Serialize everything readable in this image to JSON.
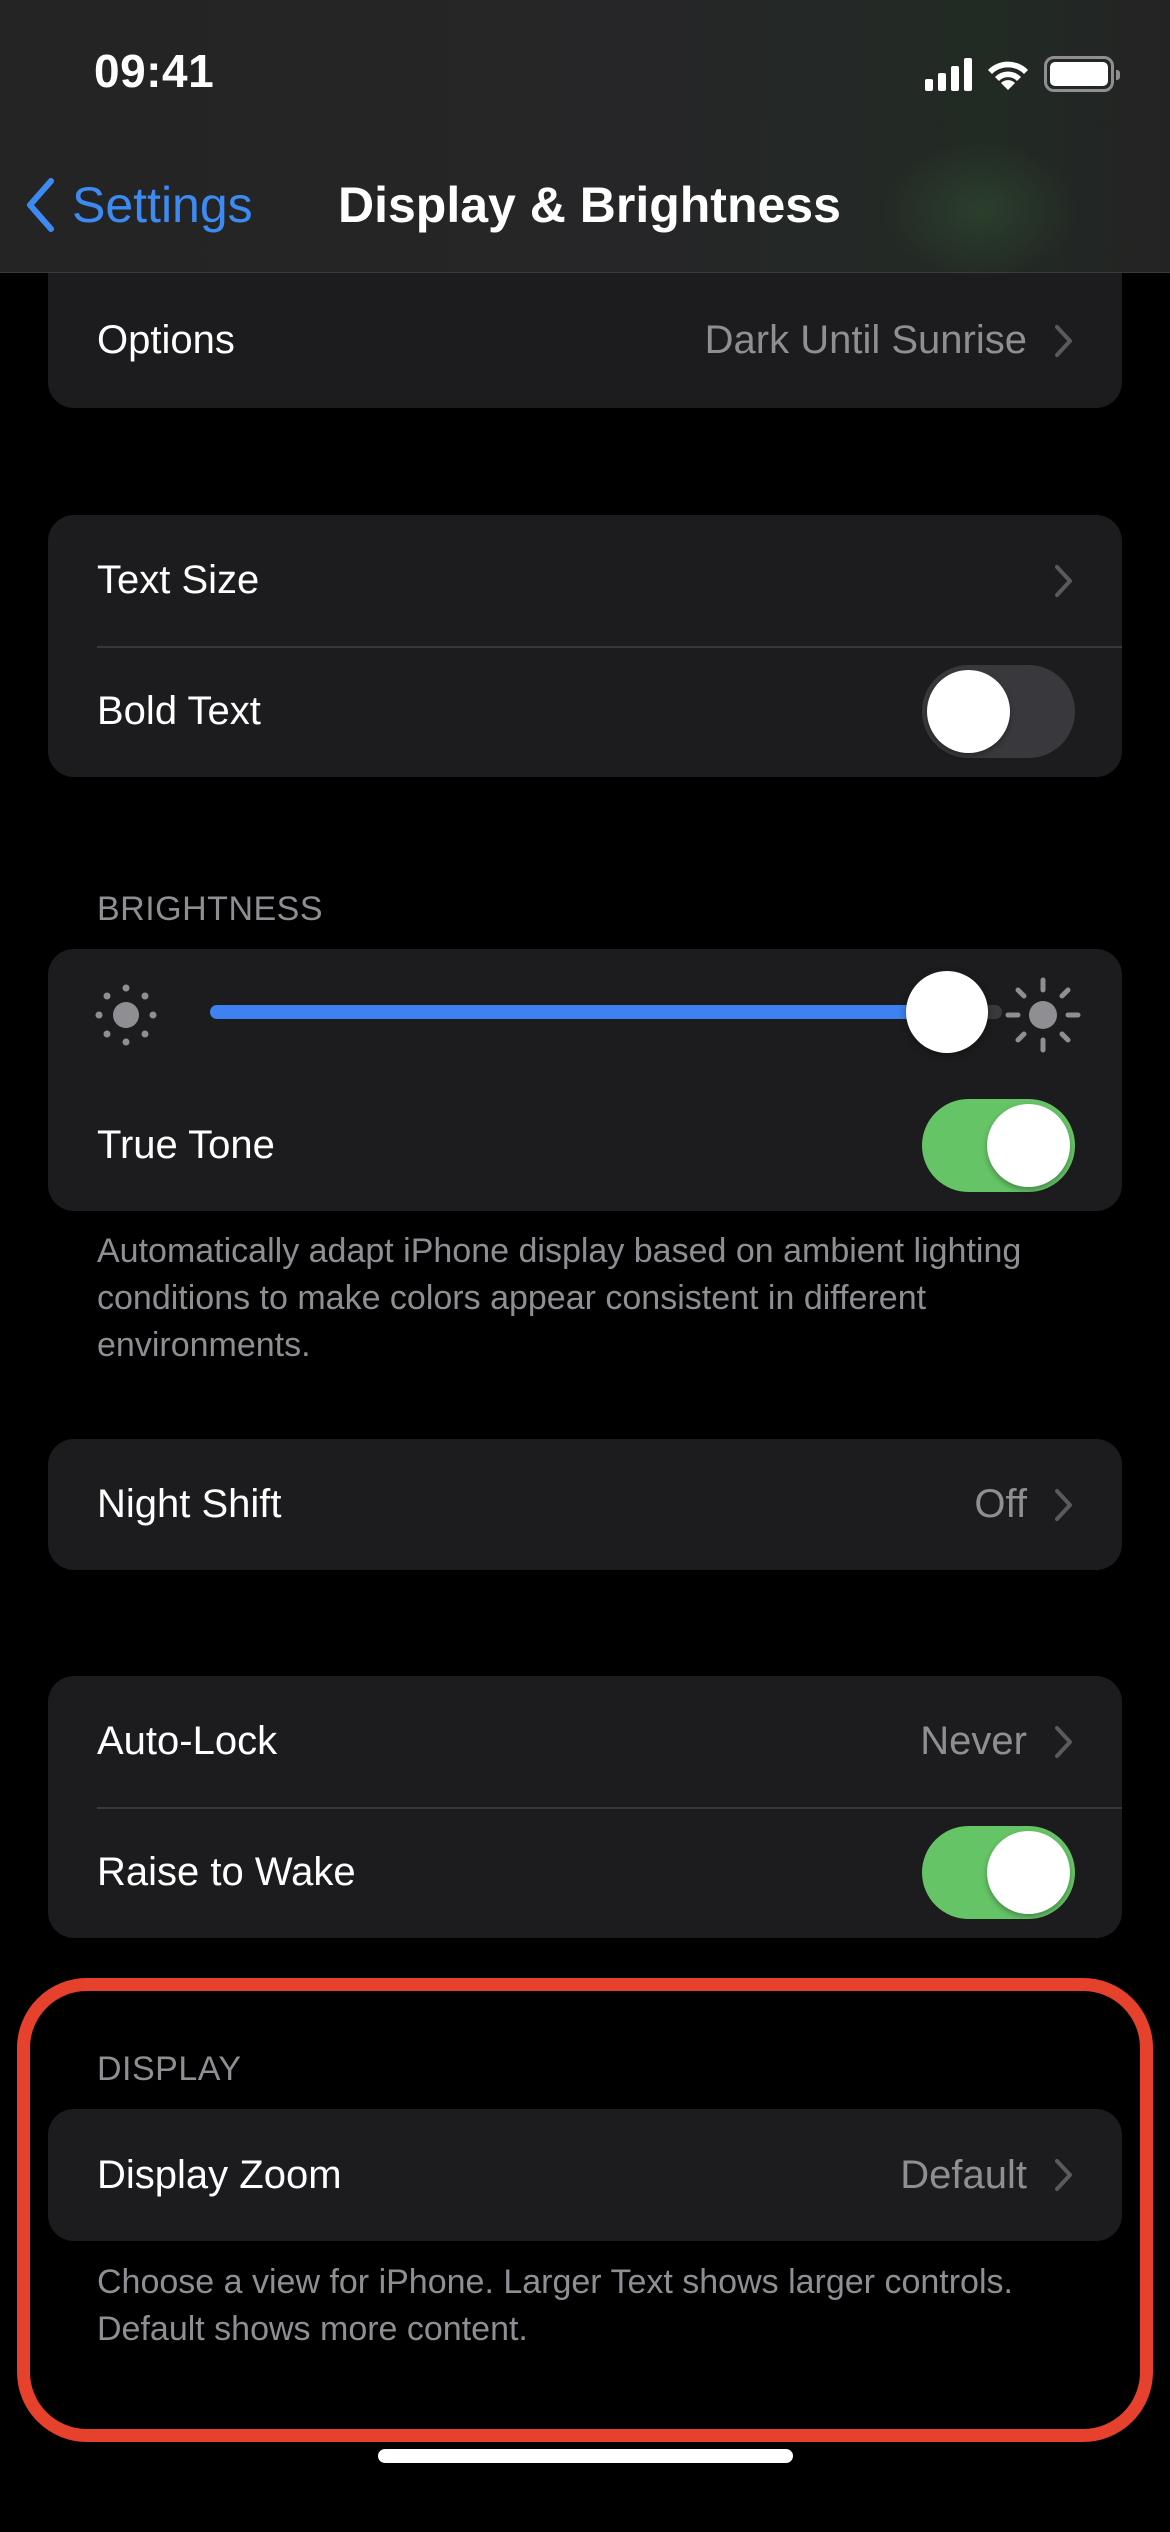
{
  "status_bar": {
    "time": "09:41",
    "icons": [
      "cellular-signal-icon",
      "wifi-icon",
      "battery-icon"
    ]
  },
  "nav": {
    "back_label": "Settings",
    "title": "Display & Brightness"
  },
  "appearance_group": {
    "rows": [
      {
        "label": "Options",
        "value": "Dark Until Sunrise",
        "accessory": "chevron"
      }
    ]
  },
  "text_group": {
    "rows": [
      {
        "label": "Text Size",
        "accessory": "chevron"
      },
      {
        "label": "Bold Text",
        "accessory": "toggle",
        "on": false
      }
    ]
  },
  "brightness_group": {
    "header": "BRIGHTNESS",
    "slider": {
      "value_percent": 93,
      "min_icon": "sun-min-icon",
      "max_icon": "sun-max-icon"
    },
    "rows": [
      {
        "label": "True Tone",
        "accessory": "toggle",
        "on": true
      }
    ],
    "footer": "Automatically adapt iPhone display based on ambient lighting conditions to make colors appear consistent in different environments."
  },
  "night_shift_group": {
    "rows": [
      {
        "label": "Night Shift",
        "value": "Off",
        "accessory": "chevron"
      }
    ]
  },
  "lock_group": {
    "rows": [
      {
        "label": "Auto-Lock",
        "value": "Never",
        "accessory": "chevron"
      },
      {
        "label": "Raise to Wake",
        "accessory": "toggle",
        "on": true
      }
    ]
  },
  "display_group": {
    "header": "DISPLAY",
    "rows": [
      {
        "label": "Display Zoom",
        "value": "Default",
        "accessory": "chevron"
      }
    ],
    "footer": "Choose a view for iPhone. Larger Text shows larger controls. Default shows more content."
  },
  "colors": {
    "accent_blue": "#3d8bf2",
    "toggle_on": "#65c466",
    "toggle_off": "#39393d",
    "highlight": "#e5412c",
    "card_bg": "#1c1c1e",
    "secondary_text": "#8e8e93"
  }
}
